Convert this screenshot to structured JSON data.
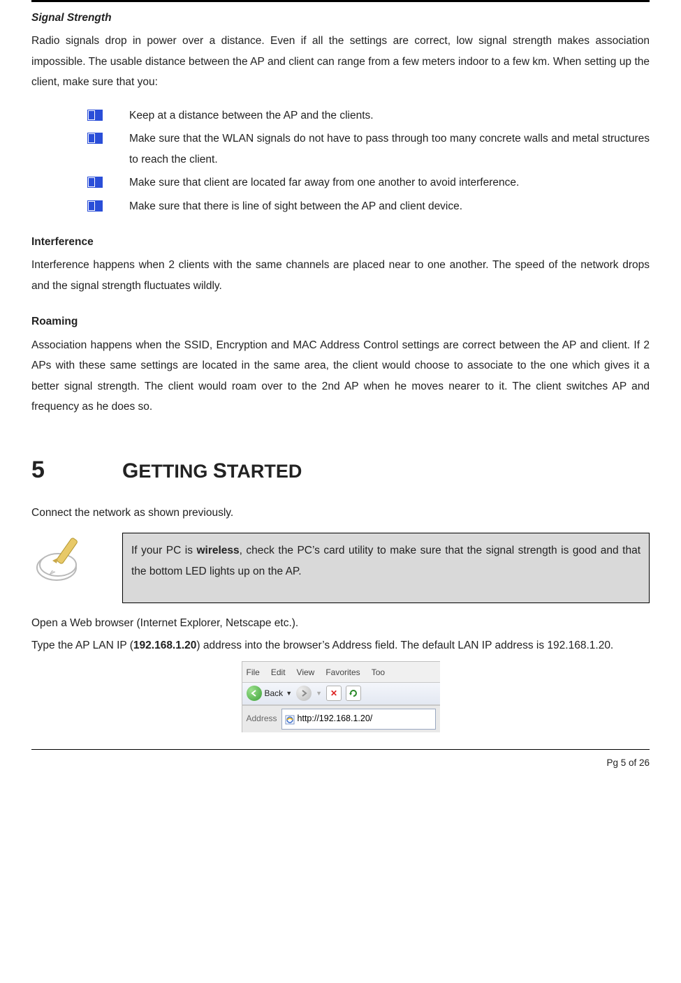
{
  "headings": {
    "signal_strength": "Signal Strength",
    "interference": "Interference",
    "roaming": "Roaming"
  },
  "paragraphs": {
    "signal_strength_p": "Radio signals drop in power over a distance. Even if all the settings are correct, low signal strength makes association impossible.  The usable distance between the AP and client can range from a few meters indoor to a few km. When setting up the client, make sure that you:",
    "interference_p": "Interference happens when 2 clients with the same channels are placed near to one another. The speed of the network drops and the signal strength fluctuates wildly.",
    "roaming_p": "Association happens when the SSID, Encryption and MAC Address Control settings are correct between the AP and client. If 2 APs with these same settings are located in the same area, the client would choose to associate to the one which gives it a better signal strength. The client would roam over to the 2nd AP when he moves nearer to it. The client switches AP and frequency as he does so.",
    "connect_p": "Connect the network as shown previously.",
    "open_browser": "Open a Web browser (Internet Explorer, Netscape etc.).",
    "type_ip_pre": "Type the AP LAN IP (",
    "type_ip_bold": "192.168.1.20",
    "type_ip_post": ") address into the browser’s Address field. The default LAN IP address is 192.168.1.20."
  },
  "bullets": [
    "Keep at a distance between the AP and the clients.",
    "Make sure that the WLAN signals do not have to pass through too many concrete walls and metal structures to reach the client.",
    "Make sure that client are located far away from one another to avoid interference.",
    "Make sure that there is line of sight between the AP and client device."
  ],
  "chapter": {
    "num": "5",
    "title_cap_1": "G",
    "title_rest_1": "ETTING ",
    "title_cap_2": "S",
    "title_rest_2": "TARTED"
  },
  "note": {
    "prefix": "If your PC is ",
    "bold": "wireless",
    "rest": ", check the PC’s card utility to make sure that the signal strength is good and that the bottom LED lights up on the AP."
  },
  "browser": {
    "menu": {
      "file": "File",
      "edit": "Edit",
      "view": "View",
      "favorites": "Favorites",
      "tools_cut": "Too"
    },
    "back": "Back",
    "address_label": "Address",
    "url": "http://192.168.1.20/"
  },
  "footer": "Pg 5 of 26"
}
